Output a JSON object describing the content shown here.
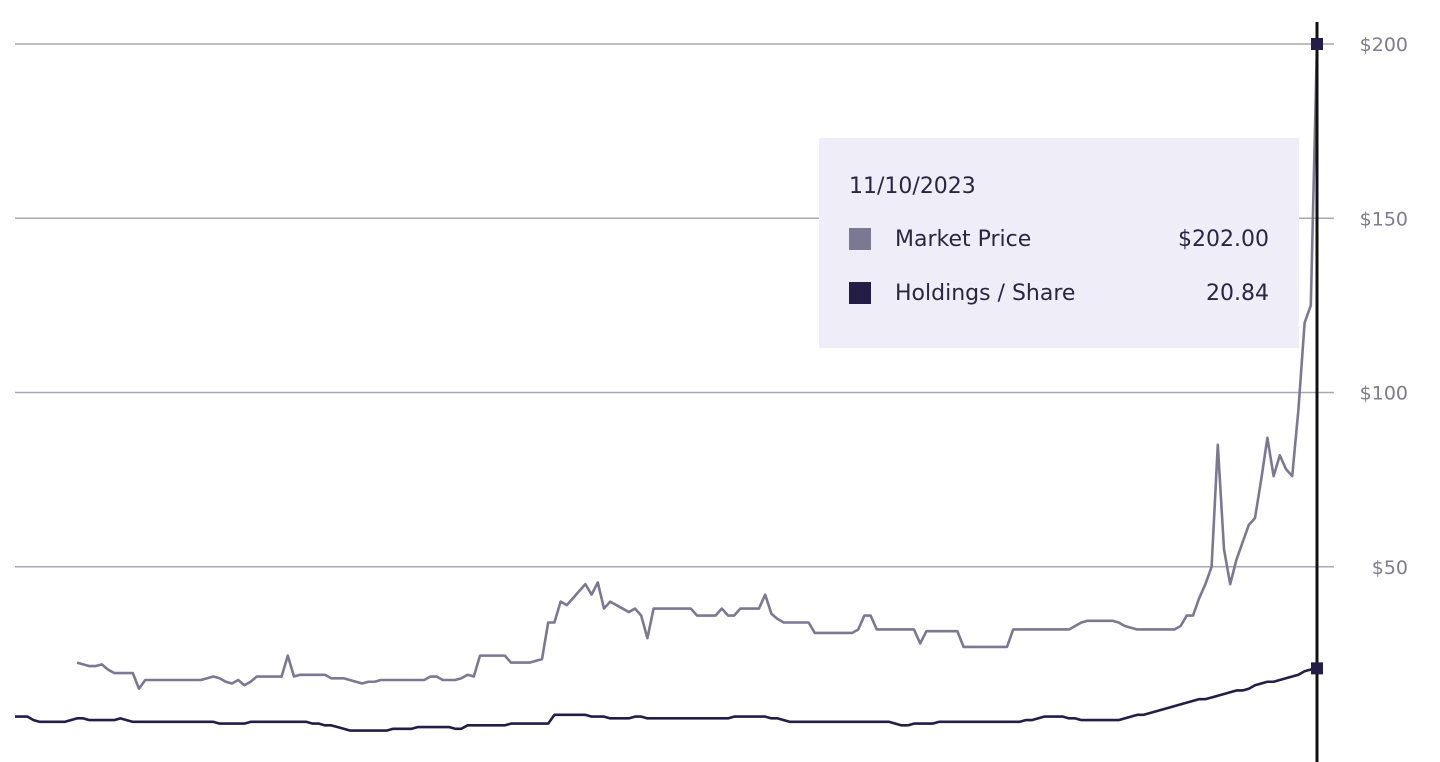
{
  "chart_data": {
    "type": "line",
    "title": "",
    "xlabel": "",
    "ylabel": "",
    "ylim": [
      0,
      200
    ],
    "y_ticks": [
      50,
      100,
      150,
      200
    ],
    "y_tick_labels": [
      "$50",
      "$100",
      "$150",
      "$200"
    ],
    "grid": true,
    "y_axis_side": "right",
    "series": [
      {
        "name": "Market Price",
        "color": "#7b7891",
        "values": [
          null,
          null,
          null,
          null,
          null,
          null,
          null,
          null,
          null,
          null,
          22.5,
          22,
          21.5,
          21.5,
          22,
          20.5,
          19.5,
          19.5,
          19.5,
          19.5,
          15,
          17.5,
          17.5,
          17.5,
          17.5,
          17.5,
          17.5,
          17.5,
          17.5,
          17.5,
          17.5,
          18,
          18.5,
          18,
          17,
          16.5,
          17.5,
          16,
          17,
          18.5,
          18.5,
          18.5,
          18.5,
          18.5,
          24.5,
          18.5,
          19,
          19,
          19,
          19,
          19,
          18,
          18,
          18,
          17.5,
          17,
          16.5,
          17,
          17,
          17.5,
          17.5,
          17.5,
          17.5,
          17.5,
          17.5,
          17.5,
          17.5,
          18.5,
          18.5,
          17.5,
          17.5,
          17.5,
          18,
          19,
          18.5,
          24.5,
          24.5,
          24.5,
          24.5,
          24.5,
          22.5,
          22.5,
          22.5,
          22.5,
          23,
          23.5,
          34,
          34,
          40,
          39,
          41,
          43,
          45,
          42,
          45.5,
          38,
          40,
          39,
          38,
          37,
          38,
          36,
          29.5,
          38,
          38,
          38,
          38,
          38,
          38,
          38,
          36,
          36,
          36,
          36,
          38,
          36,
          36,
          38,
          38,
          38,
          38,
          42,
          36.5,
          35,
          34,
          34,
          34,
          34,
          34,
          31,
          31,
          31,
          31,
          31,
          31,
          31,
          32,
          36,
          36,
          32,
          32,
          32,
          32,
          32,
          32,
          32,
          28,
          31.5,
          31.5,
          31.5,
          31.5,
          31.5,
          31.5,
          27,
          27,
          27,
          27,
          27,
          27,
          27,
          27,
          32,
          32,
          32,
          32,
          32,
          32,
          32,
          32,
          32,
          32,
          33,
          34,
          34.5,
          34.5,
          34.5,
          34.5,
          34.5,
          34,
          33,
          32.5,
          32,
          32,
          32,
          32,
          32,
          32,
          32,
          33,
          36,
          36,
          41,
          45,
          50,
          85,
          55,
          45,
          52,
          57,
          62,
          64,
          75,
          87,
          76,
          82,
          78,
          76,
          95,
          120,
          125,
          200
        ],
        "tooltip_value": "$202.00"
      },
      {
        "name": "Holdings / Share",
        "color": "#241d45",
        "values": [
          7,
          7,
          7,
          6,
          5.5,
          5.5,
          5.5,
          5.5,
          5.5,
          6,
          6.5,
          6.5,
          6,
          6,
          6,
          6,
          6,
          6.5,
          6,
          5.5,
          5.5,
          5.5,
          5.5,
          5.5,
          5.5,
          5.5,
          5.5,
          5.5,
          5.5,
          5.5,
          5.5,
          5.5,
          5.5,
          5,
          5,
          5,
          5,
          5,
          5.5,
          5.5,
          5.5,
          5.5,
          5.5,
          5.5,
          5.5,
          5.5,
          5.5,
          5.5,
          5,
          5,
          4.5,
          4.5,
          4,
          3.5,
          3,
          3,
          3,
          3,
          3,
          3,
          3,
          3.5,
          3.5,
          3.5,
          3.5,
          4,
          4,
          4,
          4,
          4,
          4,
          3.5,
          3.5,
          4.5,
          4.5,
          4.5,
          4.5,
          4.5,
          4.5,
          4.5,
          5,
          5,
          5,
          5,
          5,
          5,
          5,
          7.5,
          7.5,
          7.5,
          7.5,
          7.5,
          7.5,
          7,
          7,
          7,
          6.5,
          6.5,
          6.5,
          6.5,
          7,
          7,
          6.5,
          6.5,
          6.5,
          6.5,
          6.5,
          6.5,
          6.5,
          6.5,
          6.5,
          6.5,
          6.5,
          6.5,
          6.5,
          6.5,
          7,
          7,
          7,
          7,
          7,
          7,
          6.5,
          6.5,
          6,
          5.5,
          5.5,
          5.5,
          5.5,
          5.5,
          5.5,
          5.5,
          5.5,
          5.5,
          5.5,
          5.5,
          5.5,
          5.5,
          5.5,
          5.5,
          5.5,
          5.5,
          5,
          4.5,
          4.5,
          5,
          5,
          5,
          5,
          5.5,
          5.5,
          5.5,
          5.5,
          5.5,
          5.5,
          5.5,
          5.5,
          5.5,
          5.5,
          5.5,
          5.5,
          5.5,
          5.5,
          6,
          6,
          6.5,
          7,
          7,
          7,
          7,
          6.5,
          6.5,
          6,
          6,
          6,
          6,
          6,
          6,
          6,
          6.5,
          7,
          7.5,
          7.5,
          8,
          8.5,
          9,
          9.5,
          10,
          10.5,
          11,
          11.5,
          12,
          12,
          12.5,
          13,
          13.5,
          14,
          14.5,
          14.5,
          15,
          16,
          16.5,
          17,
          17,
          17.5,
          18,
          18.5,
          19,
          20,
          20.5,
          20.84
        ],
        "tooltip_value": "20.84"
      }
    ],
    "tooltip": {
      "date": "11/10/2023",
      "rows": [
        {
          "label": "Market Price",
          "value": "$202.00",
          "color": "#7b7891"
        },
        {
          "label": "Holdings / Share",
          "value": "20.84",
          "color": "#241d45"
        }
      ]
    }
  }
}
